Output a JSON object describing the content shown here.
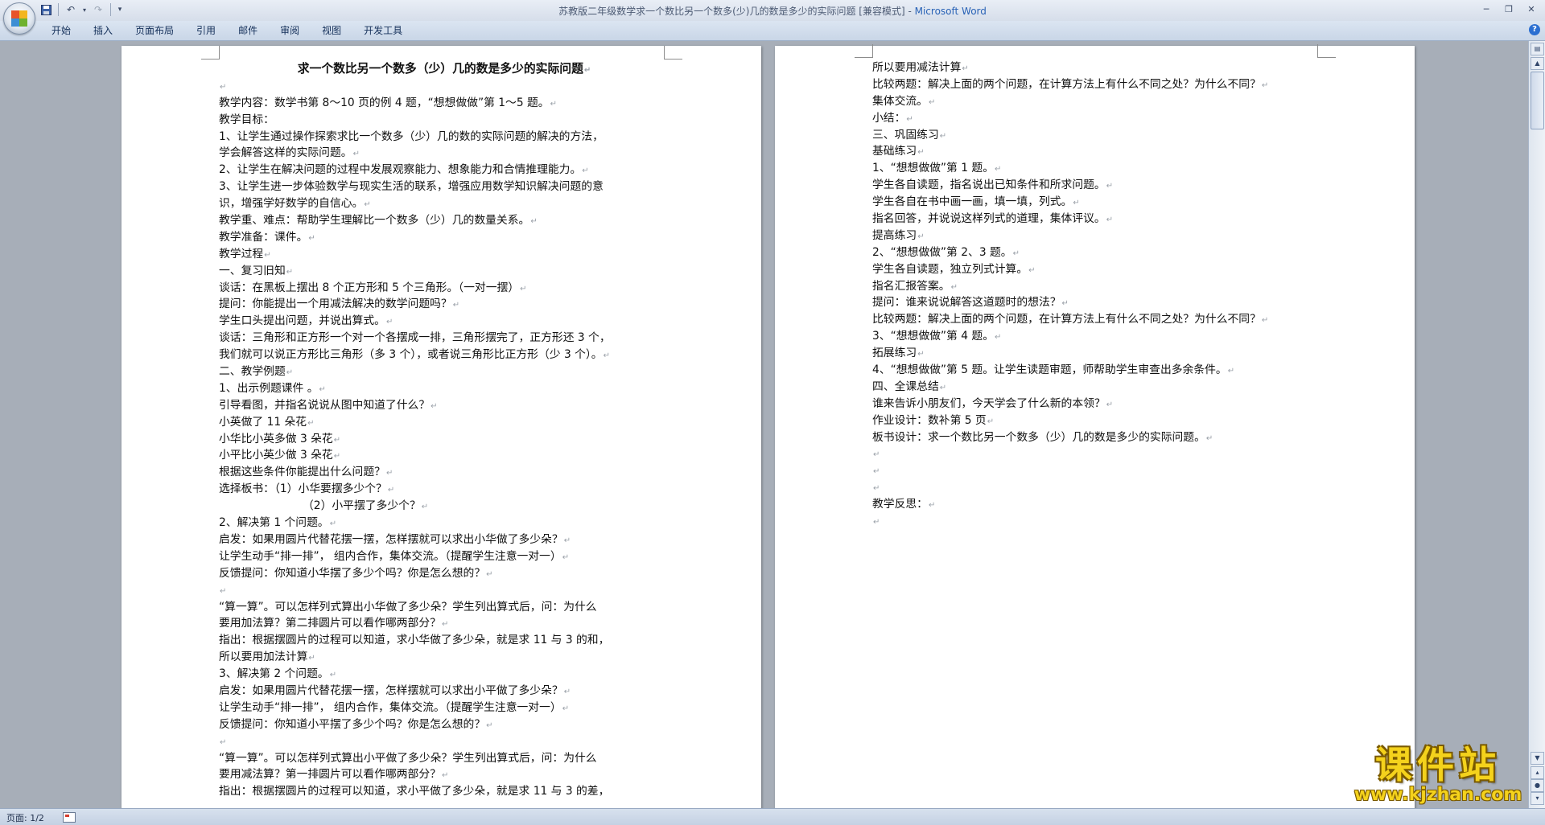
{
  "window": {
    "title": "苏教版二年级数学求一个数比另一个数多(少)几的数是多少的实际问题 [兼容模式] - ",
    "app_name": "Microsoft Word"
  },
  "quick_access": [
    "save-icon",
    "undo-icon",
    "redo-icon",
    "customize-icon"
  ],
  "ribbon": {
    "tabs": [
      "开始",
      "插入",
      "页面布局",
      "引用",
      "邮件",
      "审阅",
      "视图",
      "开发工具"
    ]
  },
  "document": {
    "left_page": {
      "lines": [
        {
          "t": "求一个数比另一个数多（少）几的数是多少的实际问题",
          "s": "title"
        },
        {
          "t": ""
        },
        {
          "t": "教学内容：数学书第 8～10 页的例 4 题，“想想做做”第 1～5 题。"
        },
        {
          "t": "教学目标：",
          "nomark": true
        },
        {
          "t": "1、让学生通过操作探索求比一个数多（少）几的数的实际问题的解决的方法，",
          "nomark": true
        },
        {
          "t": "学会解答这样的实际问题。"
        },
        {
          "t": "2、让学生在解决问题的过程中发展观察能力、想象能力和合情推理能力。"
        },
        {
          "t": "3、让学生进一步体验数学与现实生活的联系，增强应用数学知识解决问题的意",
          "nomark": true
        },
        {
          "t": "识，增强学好数学的自信心。"
        },
        {
          "t": "教学重、难点：帮助学生理解比一个数多（少）几的数量关系。"
        },
        {
          "t": "教学准备：课件。"
        },
        {
          "t": "教学过程"
        },
        {
          "t": "一、复习旧知"
        },
        {
          "t": "谈话：在黑板上摆出 8 个正方形和 5 个三角形。（一对一摆）"
        },
        {
          "t": "提问：你能提出一个用减法解决的数学问题吗？"
        },
        {
          "t": "学生口头提出问题，并说出算式。"
        },
        {
          "t": "谈话：三角形和正方形一个对一个各摆成一排，三角形摆完了，正方形还 3 个，",
          "nomark": true
        },
        {
          "t": "我们就可以说正方形比三角形（多 3 个），或者说三角形比正方形（少 3 个）。"
        },
        {
          "t": "二、教学例题"
        },
        {
          "t": "1、出示例题课件 。"
        },
        {
          "t": "引导看图，并指名说说从图中知道了什么？"
        },
        {
          "t": "小英做了 11 朵花"
        },
        {
          "t": "小华比小英多做 3 朵花"
        },
        {
          "t": "小平比小英少做 3 朵花"
        },
        {
          "t": "根据这些条件你能提出什么问题？"
        },
        {
          "t": "选择板书：（1）小华要摆多少个？"
        },
        {
          "t": "（2）小平摆了多少个？",
          "s": "indent"
        },
        {
          "t": "2、解决第 1 个问题。"
        },
        {
          "t": "启发：如果用圆片代替花摆一摆，怎样摆就可以求出小华做了多少朵？"
        },
        {
          "t": "让学生动手“排一排”， 组内合作，集体交流。（提醒学生注意一对一）"
        },
        {
          "t": "反馈提问：你知道小华摆了多少个吗？你是怎么想的？"
        },
        {
          "t": ""
        },
        {
          "t": "“算一算”。可以怎样列式算出小华做了多少朵？学生列出算式后，问：为什么",
          "nomark": true
        },
        {
          "t": "要用加法算？第二排圆片可以看作哪两部分？"
        },
        {
          "t": "指出：根据摆圆片的过程可以知道，求小华做了多少朵，就是求 11 与 3 的和，",
          "nomark": true
        },
        {
          "t": "所以要用加法计算"
        },
        {
          "t": "3、解决第 2 个问题。"
        },
        {
          "t": "启发：如果用圆片代替花摆一摆，怎样摆就可以求出小平做了多少朵？"
        },
        {
          "t": "让学生动手“排一排”， 组内合作，集体交流。（提醒学生注意一对一）"
        },
        {
          "t": "反馈提问：你知道小平摆了多少个吗？你是怎么想的？"
        },
        {
          "t": ""
        },
        {
          "t": "“算一算”。可以怎样列式算出小平做了多少朵？学生列出算式后，问：为什么",
          "nomark": true
        },
        {
          "t": "要用减法算？第一排圆片可以看作哪两部分？"
        },
        {
          "t": "指出：根据摆圆片的过程可以知道，求小平做了多少朵，就是求 11 与 3 的差，",
          "nomark": true
        }
      ]
    },
    "right_page": {
      "lines": [
        {
          "t": "所以要用减法计算"
        },
        {
          "t": "比较两题：解决上面的两个问题，在计算方法上有什么不同之处？为什么不同？"
        },
        {
          "t": "集体交流。"
        },
        {
          "t": "小结："
        },
        {
          "t": "三、巩固练习"
        },
        {
          "t": "基础练习"
        },
        {
          "t": "1、“想想做做”第 1 题。"
        },
        {
          "t": "学生各自读题，指名说出已知条件和所求问题。"
        },
        {
          "t": "学生各自在书中画一画，填一填，列式。"
        },
        {
          "t": "指名回答，并说说这样列式的道理，集体评议。"
        },
        {
          "t": "提高练习"
        },
        {
          "t": "2、“想想做做”第 2、3 题。"
        },
        {
          "t": "学生各自读题，独立列式计算。"
        },
        {
          "t": "指名汇报答案。"
        },
        {
          "t": "提问：谁来说说解答这道题时的想法？"
        },
        {
          "t": "比较两题：解决上面的两个问题，在计算方法上有什么不同之处？为什么不同？"
        },
        {
          "t": "3、“想想做做”第 4 题。"
        },
        {
          "t": "拓展练习"
        },
        {
          "t": "4、“想想做做”第 5 题。让学生读题审题，师帮助学生审查出多余条件。"
        },
        {
          "t": "四、全课总结"
        },
        {
          "t": "谁来告诉小朋友们，今天学会了什么新的本领？"
        },
        {
          "t": "作业设计：数补第 5 页"
        },
        {
          "t": "板书设计：求一个数比另一个数多（少）几的数是多少的实际问题。"
        },
        {
          "t": ""
        },
        {
          "t": ""
        },
        {
          "t": ""
        },
        {
          "t": "教学反思："
        },
        {
          "t": ""
        }
      ]
    }
  },
  "statusbar": {
    "page_info": "页面: 1/2"
  },
  "watermark": {
    "name": "课件站",
    "url": "www.kjzhan.com"
  }
}
